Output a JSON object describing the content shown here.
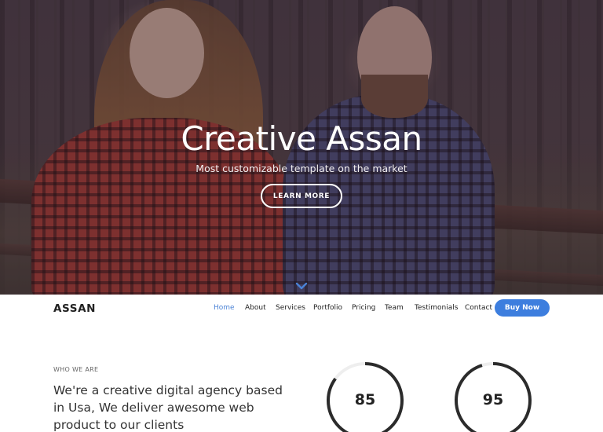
{
  "hero": {
    "title": "Creative Assan",
    "subtitle": "Most customizable template on the market",
    "cta_label": "LEARN MORE",
    "scroll_icon": "chevron-down-icon"
  },
  "navbar": {
    "brand": "ASSAN",
    "items": [
      {
        "label": "Home",
        "active": true
      },
      {
        "label": "About"
      },
      {
        "label": "Services"
      },
      {
        "label": "Portfolio"
      },
      {
        "label": "Pricing"
      },
      {
        "label": "Team"
      },
      {
        "label": "Testimonials"
      },
      {
        "label": "Contact"
      }
    ],
    "buy_label": "Buy Now"
  },
  "about": {
    "eyebrow": "WHO WE ARE",
    "text": "We're a creative digital agency based in Usa, We deliver awesome web product to our clients",
    "stats": [
      {
        "value": "85",
        "percent": 85
      },
      {
        "value": "95",
        "percent": 95
      }
    ]
  },
  "colors": {
    "accent": "#3d7ede",
    "active_nav": "#4a82d6",
    "ring": "#2b2b2b",
    "ring_track": "#eeeeee"
  }
}
